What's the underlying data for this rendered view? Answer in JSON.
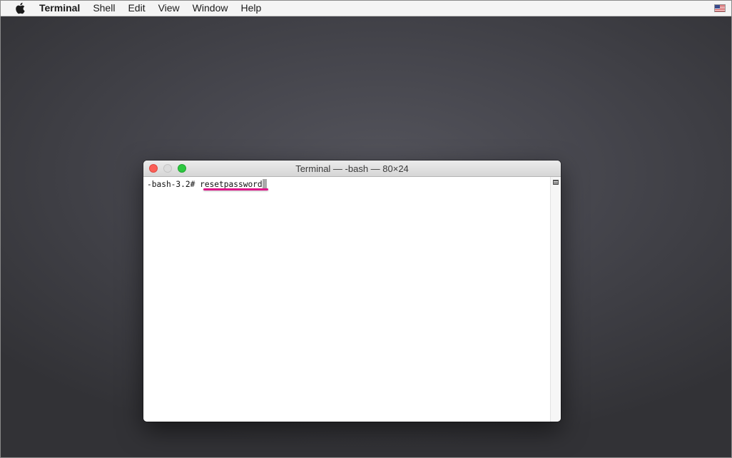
{
  "menubar": {
    "apple_icon": "apple-logo-icon",
    "app_name": "Terminal",
    "items": [
      "Shell",
      "Edit",
      "View",
      "Window",
      "Help"
    ],
    "input_source_icon": "us-flag-icon"
  },
  "window": {
    "title": "Terminal — -bash — 80×24",
    "traffic_lights": {
      "close_color": "#fc5f57",
      "minimize_color": "#dcdcdc",
      "zoom_color": "#2dc840"
    },
    "terminal": {
      "prompt": "-bash-3.2# ",
      "command": "resetpassword"
    }
  },
  "annotation": {
    "underline_color": "#e0168a"
  }
}
